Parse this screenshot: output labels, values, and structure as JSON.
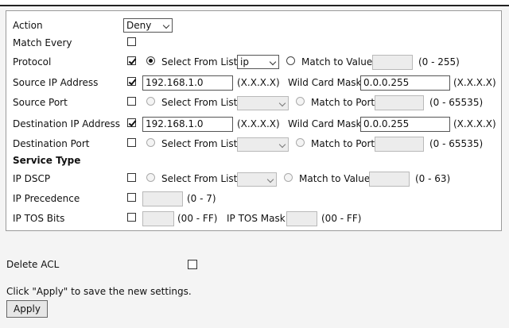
{
  "rows": {
    "action": {
      "label": "Action",
      "value": "Deny"
    },
    "match_every": {
      "label": "Match Every"
    },
    "protocol": {
      "label": "Protocol",
      "select_from_list": "Select From List",
      "list_value": "ip",
      "match_to_value": "Match to Value",
      "range": "(0 - 255)"
    },
    "source_ip": {
      "label": "Source IP Address",
      "value": "192.168.1.0",
      "hint": "(X.X.X.X)",
      "mask_label": "Wild Card Mask",
      "mask_value": "0.0.0.255",
      "mask_hint": "(X.X.X.X)"
    },
    "source_port": {
      "label": "Source Port",
      "select_from_list": "Select From List",
      "match_to_port": "Match to Port",
      "range": "(0 - 65535)"
    },
    "dest_ip": {
      "label": "Destination IP Address",
      "value": "192.168.1.0",
      "hint": "(X.X.X.X)",
      "mask_label": "Wild Card Mask",
      "mask_value": "0.0.0.255",
      "mask_hint": "(X.X.X.X)"
    },
    "dest_port": {
      "label": "Destination Port",
      "select_from_list": "Select From List",
      "match_to_port": "Match to Port",
      "range": "(0 - 65535)"
    },
    "service_type": {
      "label": "Service Type"
    },
    "ip_dscp": {
      "label": "IP DSCP",
      "select_from_list": "Select From List",
      "match_to_value": "Match to Value",
      "range": "(0 - 63)"
    },
    "ip_precedence": {
      "label": "IP Precedence",
      "range": "(0 - 7)"
    },
    "ip_tos": {
      "label": "IP TOS Bits",
      "range": "(00 - FF)",
      "mask_label": "IP TOS Mask",
      "mask_range": "(00 - FF)"
    }
  },
  "delete_acl": {
    "label": "Delete ACL"
  },
  "hint_text": "Click \"Apply\" to save the new settings.",
  "apply_label": "Apply"
}
